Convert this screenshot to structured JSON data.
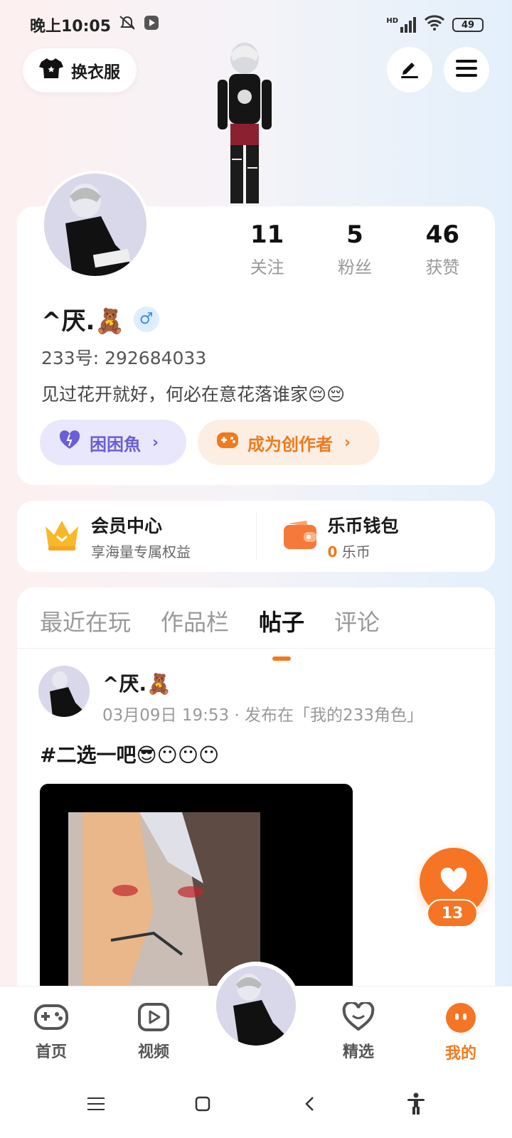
{
  "status_bar": {
    "time": "晚上10:05",
    "network_badge": "HD",
    "battery": "49"
  },
  "top": {
    "outfit_label": "换衣服",
    "edit_icon": "edit-icon",
    "menu_icon": "menu-icon"
  },
  "profile": {
    "stats": [
      {
        "value": "11",
        "label": "关注"
      },
      {
        "value": "5",
        "label": "粉丝"
      },
      {
        "value": "46",
        "label": "获赞"
      }
    ],
    "username": "^厌.🧸",
    "gender_symbol": "♂",
    "user_id": "233号: 292684033",
    "bio": "见过花开就好，何必在意花落谁家😔😔",
    "tags": [
      {
        "label": "困困魚",
        "icon": "heart-icon",
        "color": "#6a5fd6"
      },
      {
        "label": "成为创作者",
        "icon": "gamepad-icon",
        "color": "#f07a1c"
      }
    ]
  },
  "vip": {
    "member_title": "会员中心",
    "member_sub": "享海量专属权益",
    "wallet_title": "乐币钱包",
    "coin_amount": "0",
    "coin_unit": "乐币"
  },
  "tabs": [
    "最近在玩",
    "作品栏",
    "帖子",
    "评论"
  ],
  "active_tab": "帖子",
  "post": {
    "author": "^厌.🧸",
    "meta": "03月09日 19:53 · 发布在「我的233角色」",
    "text": "#二选一吧😎😶😶😶",
    "like_count": "13"
  },
  "bottom_nav": {
    "items": [
      {
        "label": "首页",
        "icon": "gamepad-icon"
      },
      {
        "label": "视频",
        "icon": "play-icon"
      },
      {
        "label": "精选",
        "icon": "heart-icon"
      },
      {
        "label": "我的",
        "icon": "face-icon"
      }
    ]
  },
  "colors": {
    "accent": "#f07a1c",
    "purple": "#6a5fd6"
  }
}
